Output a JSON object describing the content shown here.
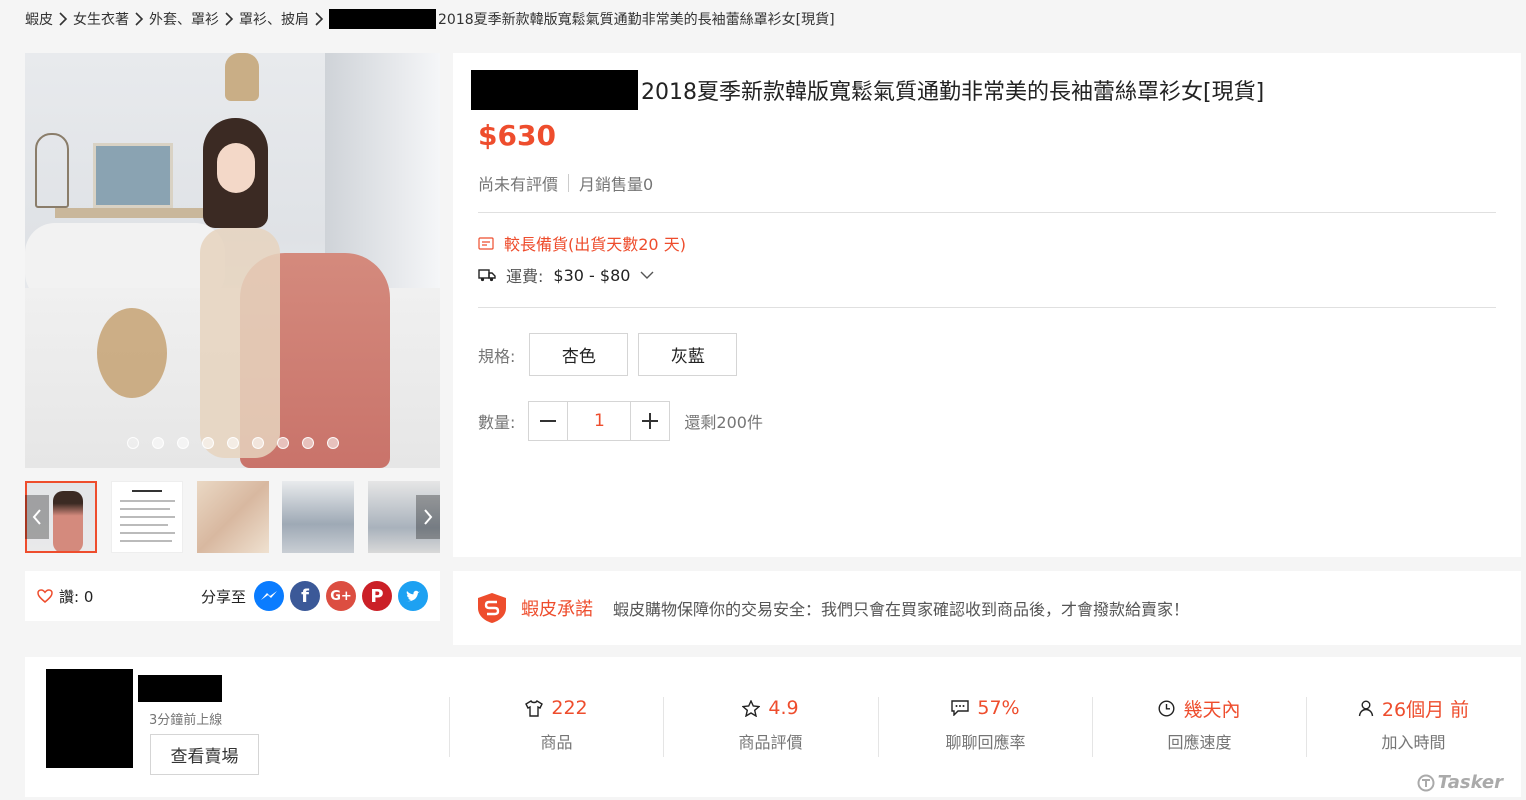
{
  "breadcrumb": [
    "蝦皮",
    "女生衣著",
    "外套、罩衫",
    "罩衫、披肩",
    "2018夏季新款韓版寬鬆氣質通勤非常美的長袖蕾絲罩衫女[現貨]"
  ],
  "product": {
    "title": "2018夏季新款韓版寬鬆氣質通勤非常美的長袖蕾絲罩衫女[現貨]",
    "price": "$630",
    "rating_text": "尚未有評價",
    "monthly_sales": "月銷售量0",
    "preorder": "較長備貨(出貨天數20 天)",
    "shipping_label": "運費:",
    "shipping_value": "$30 - $80",
    "variation_label": "規格:",
    "variations": [
      "杏色",
      "灰藍"
    ],
    "quantity_label": "數量:",
    "quantity": "1",
    "stock": "還剩200件"
  },
  "social": {
    "like_text": "讚: 0",
    "share_label": "分享至",
    "share_icons": [
      "messenger-icon",
      "facebook-icon",
      "google-plus-icon",
      "pinterest-icon",
      "twitter-icon"
    ]
  },
  "guarantee": {
    "title": "蝦皮承諾",
    "text": "蝦皮購物保障你的交易安全：我們只會在買家確認收到商品後，才會撥款給賣家！"
  },
  "shop": {
    "online": "3分鐘前上線",
    "view_button": "查看賣場",
    "stats": [
      {
        "icon": "shirt-icon",
        "value": "222",
        "label": "商品"
      },
      {
        "icon": "star-icon",
        "value": "4.9",
        "label": "商品評價"
      },
      {
        "icon": "chat-icon",
        "value": "57%",
        "label": "聊聊回應率"
      },
      {
        "icon": "clock-icon",
        "value": "幾天內",
        "label": "回應速度"
      },
      {
        "icon": "person-icon",
        "value": "26個月 前",
        "label": "加入時間"
      }
    ]
  },
  "watermark": "Tasker",
  "colors": {
    "accent": "#ee4d2d",
    "background": "#f5f5f5"
  }
}
